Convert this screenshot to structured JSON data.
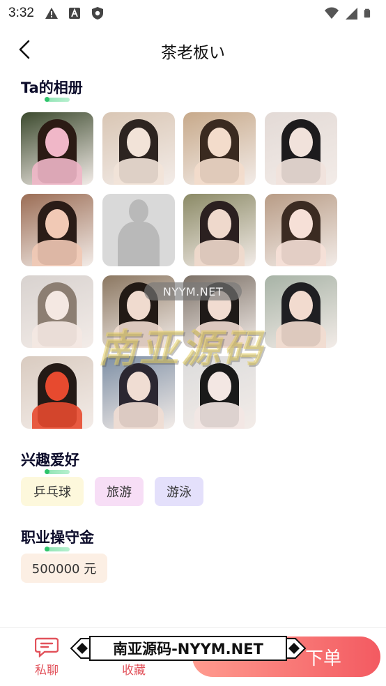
{
  "status_bar": {
    "time": "3:32",
    "left_icons": [
      "warning-icon",
      "text-a-icon",
      "shield-icon"
    ],
    "right_icons": [
      "wifi-icon",
      "signal-icon",
      "battery-icon"
    ]
  },
  "header": {
    "title": "茶老板い",
    "back_icon": "chevron-left-icon"
  },
  "album": {
    "title": "Ta的相册",
    "photos": [
      {
        "name": "photo-1",
        "palette": [
          "#3c4a2e",
          "#f0b7c8",
          "#2b1b14"
        ]
      },
      {
        "name": "photo-2",
        "palette": [
          "#d9c6b4",
          "#f2e3d8",
          "#2d2420"
        ]
      },
      {
        "name": "photo-3",
        "palette": [
          "#c7a98a",
          "#f3dccb",
          "#3a2a20"
        ]
      },
      {
        "name": "photo-4",
        "palette": [
          "#e3dad6",
          "#f1e2db",
          "#1d1b1d"
        ]
      },
      {
        "name": "photo-5",
        "palette": [
          "#9b6d55",
          "#f1c9b5",
          "#2a1c17"
        ]
      },
      {
        "name": "photo-6-placeholder",
        "palette": [
          "#d9d9d9",
          "#b9b9b9",
          "#b9b9b9"
        ]
      },
      {
        "name": "photo-7",
        "palette": [
          "#8b8a66",
          "#efd9cc",
          "#2b2020"
        ]
      },
      {
        "name": "photo-8",
        "palette": [
          "#b89c86",
          "#f6e0d7",
          "#3b2b22"
        ]
      },
      {
        "name": "photo-9",
        "palette": [
          "#d8d2cf",
          "#f4e8e2",
          "#8c7e72"
        ]
      },
      {
        "name": "photo-10",
        "palette": [
          "#8b7761",
          "#f0dbcf",
          "#221a15"
        ]
      },
      {
        "name": "photo-11",
        "palette": [
          "#7b7066",
          "#f1dcd1",
          "#1f1a18"
        ]
      },
      {
        "name": "photo-12",
        "palette": [
          "#a7b3a6",
          "#f2dbcf",
          "#1f1f22"
        ]
      },
      {
        "name": "photo-13",
        "palette": [
          "#d9cbc0",
          "#e74a2f",
          "#241a16"
        ]
      },
      {
        "name": "photo-14",
        "palette": [
          "#7d8fa5",
          "#f0ddd3",
          "#2b2731"
        ]
      },
      {
        "name": "photo-15",
        "palette": [
          "#dcdcdc",
          "#f3e7e3",
          "#1a1a1a"
        ]
      }
    ]
  },
  "interests": {
    "title": "兴趣爱好",
    "tags": [
      {
        "label": "乒乓球",
        "bg": "#fdf8dc"
      },
      {
        "label": "旅游",
        "bg": "#f7def6"
      },
      {
        "label": "游泳",
        "bg": "#e4e0fb"
      }
    ]
  },
  "deposit": {
    "title": "职业操守金",
    "amount": "500000 元",
    "bg": "#fcefe4"
  },
  "watermark": {
    "pill_text": "NYYM.NET",
    "big_text": "南亚源码",
    "banner_text": "南亚源码-NYYM.NET"
  },
  "bottom_bar": {
    "chat_label": "私聊",
    "chat_icon": "chat-bubble-icon",
    "favorite_label": "收藏",
    "favorite_icon": "star-icon",
    "order_label": "下单",
    "accent": "#f35a61"
  }
}
